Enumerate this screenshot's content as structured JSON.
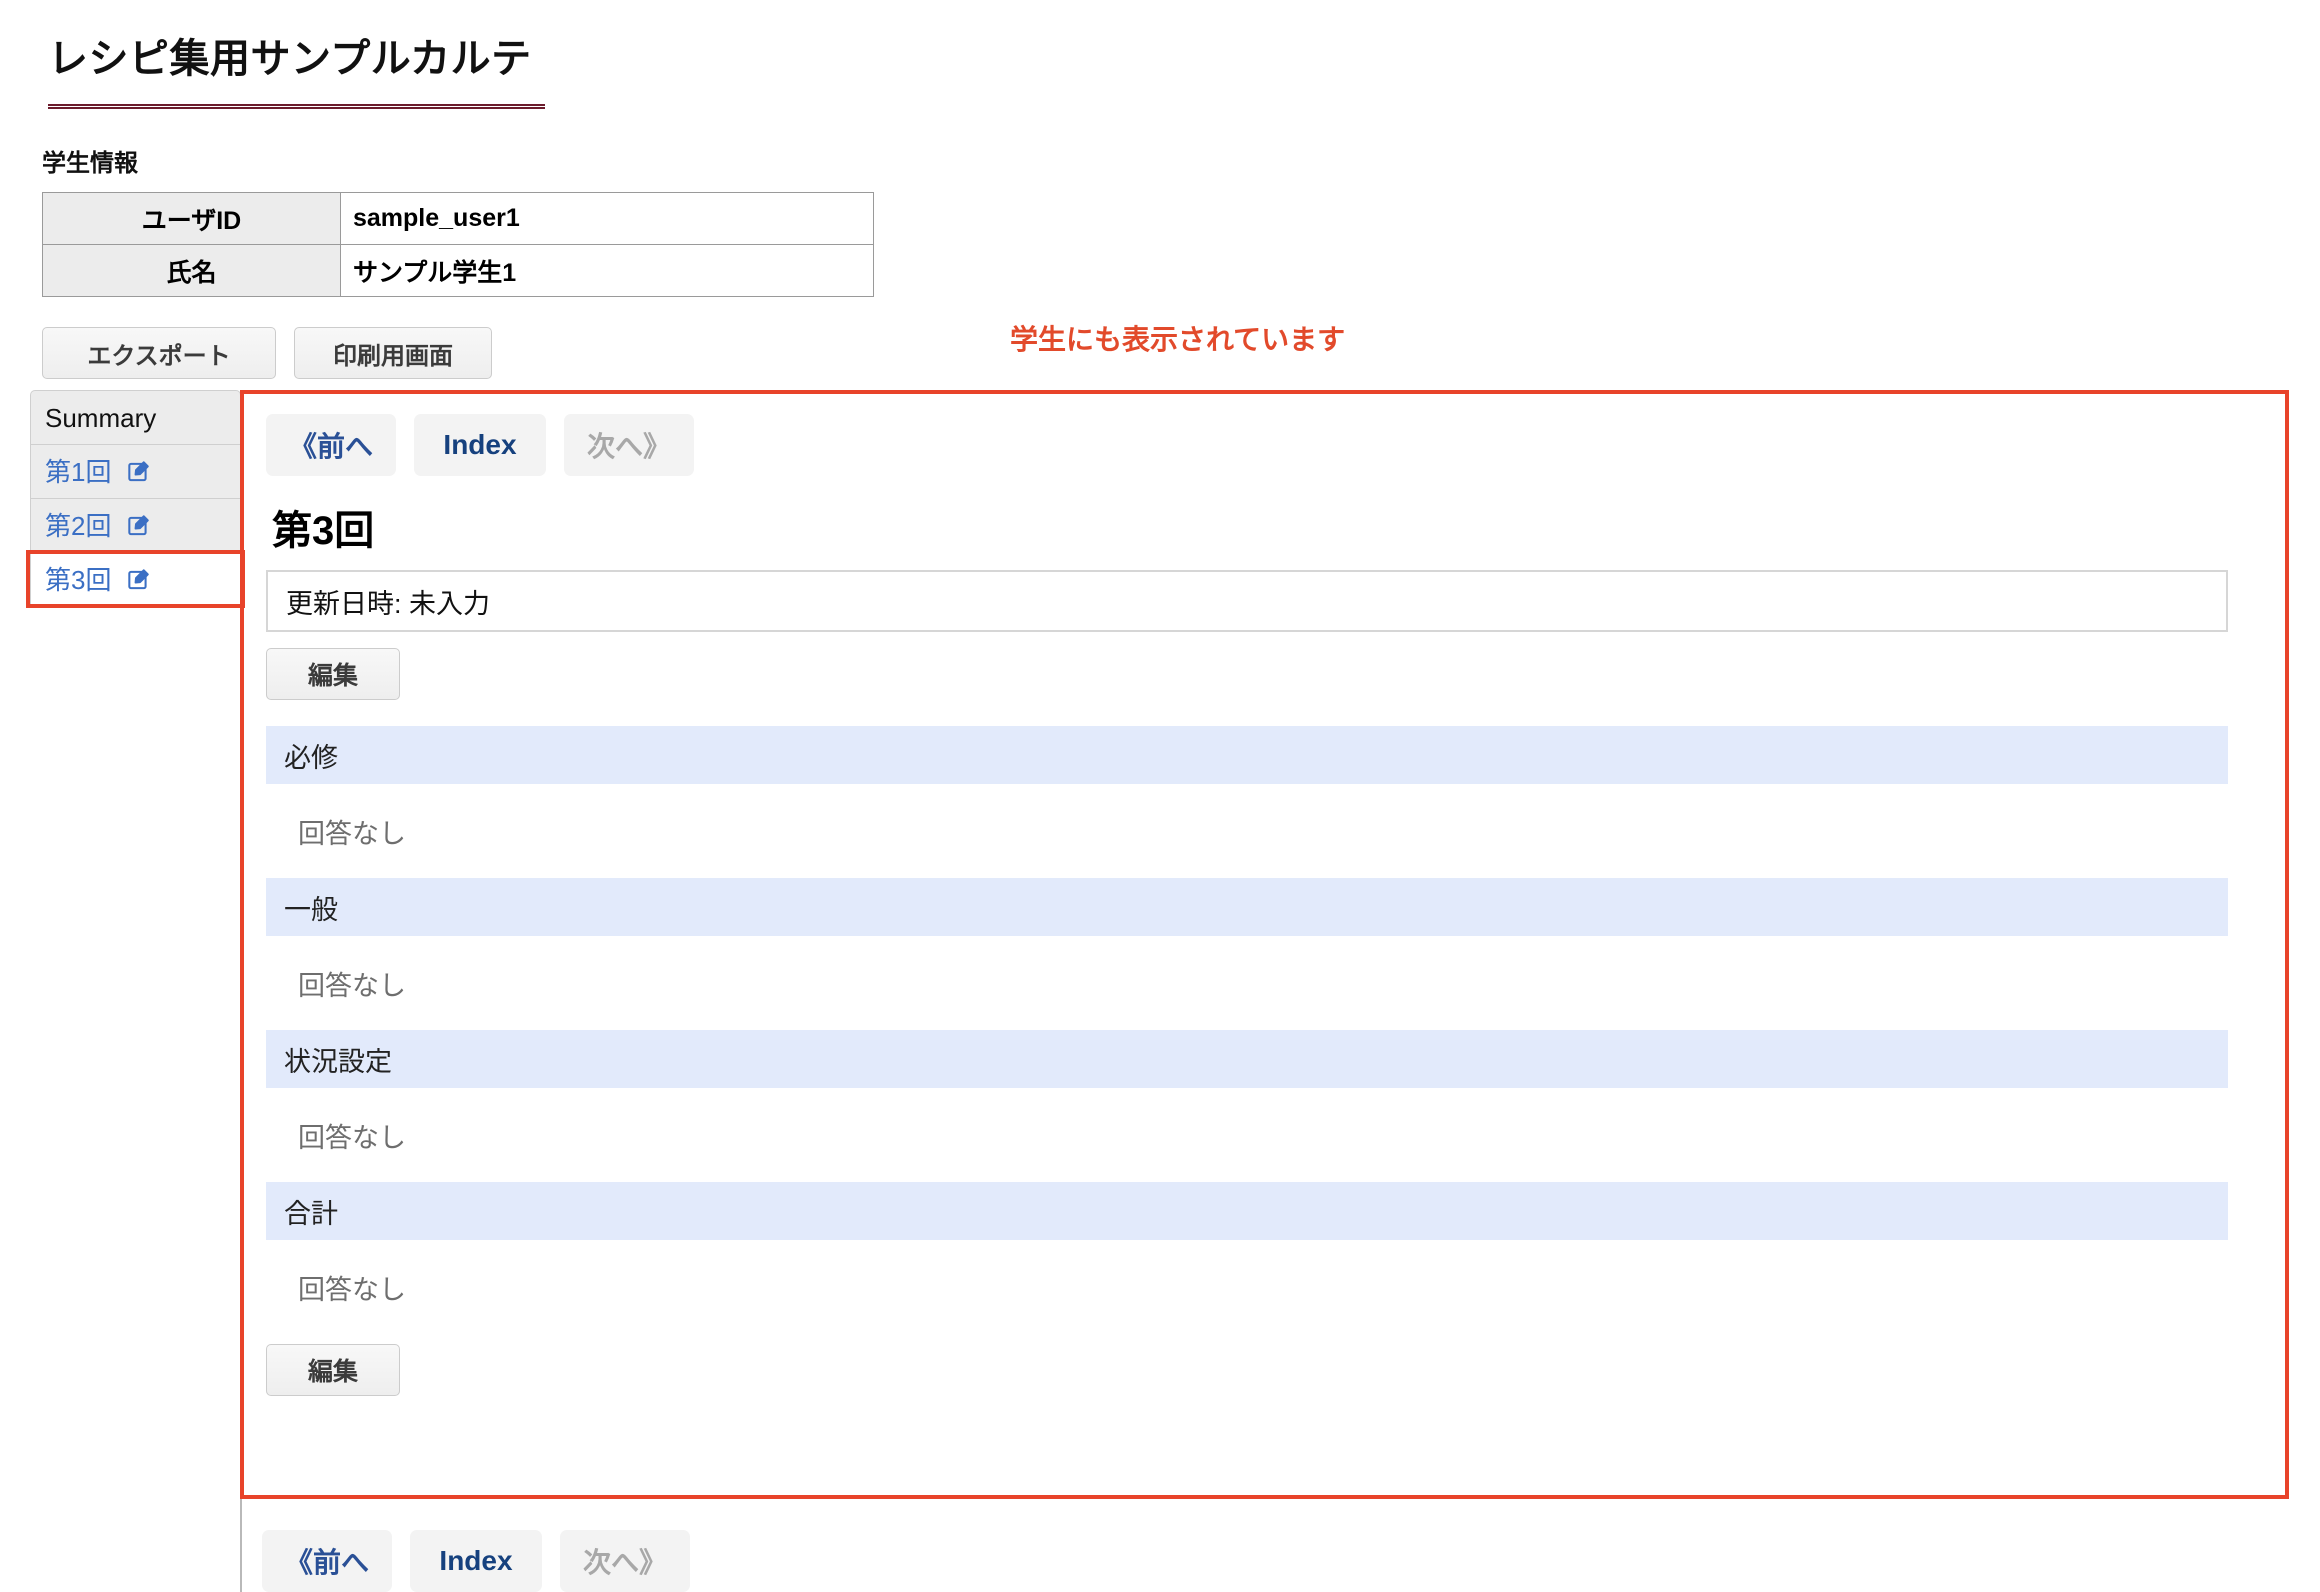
{
  "header": {
    "title": "レシピ集用サンプルカルテ"
  },
  "student_info": {
    "label": "学生情報",
    "rows": [
      {
        "key": "ユーザID",
        "value": "sample_user1"
      },
      {
        "key": "氏名",
        "value": "サンプル学生1"
      }
    ]
  },
  "actions": {
    "export_label": "エクスポート",
    "print_label": "印刷用画面"
  },
  "annotation": {
    "text": "学生にも表示されています",
    "color": "#e24a2b"
  },
  "sidebar": {
    "items": [
      {
        "label": "Summary",
        "icon": null,
        "current": false
      },
      {
        "label": "第1回",
        "icon": "edit-icon",
        "current": false
      },
      {
        "label": "第2回",
        "icon": "edit-icon",
        "current": false
      },
      {
        "label": "第3回",
        "icon": "edit-icon",
        "current": true
      }
    ]
  },
  "main": {
    "nav": {
      "prev_label": "《前へ",
      "index_label": "Index",
      "next_label": "次へ》"
    },
    "round_title": "第3回",
    "updated_text": "更新日時: 未入力",
    "edit_label_top": "編集",
    "edit_label_bottom": "編集",
    "sections": [
      {
        "title": "必修",
        "body": "回答なし"
      },
      {
        "title": "一般",
        "body": "回答なし"
      },
      {
        "title": "状況設定",
        "body": "回答なし"
      },
      {
        "title": "合計",
        "body": "回答なし"
      }
    ]
  },
  "bottom_nav": {
    "prev_label": "《前へ",
    "index_label": "Index",
    "next_label": "次へ》"
  },
  "colors": {
    "title_rule": "#6b1b2c",
    "highlight_border": "#e8432a",
    "section_header_bg": "#e2eafb",
    "link_blue": "#3b6fc4",
    "index_blue": "#16417e",
    "disabled_gray": "#a8a8a8"
  }
}
